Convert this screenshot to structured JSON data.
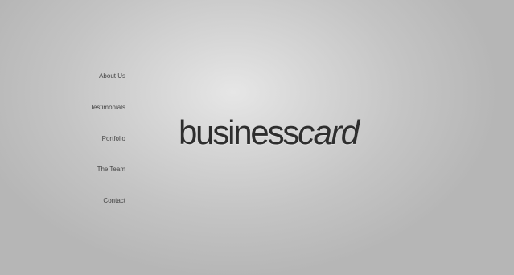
{
  "nav": {
    "items": [
      {
        "label": "About Us"
      },
      {
        "label": "Testimonials"
      },
      {
        "label": "Portfolio"
      },
      {
        "label": "The Team"
      },
      {
        "label": "Contact"
      }
    ]
  },
  "logo": {
    "part_regular": "business",
    "part_italic": "card"
  },
  "colors": {
    "background": "#c4c4c4",
    "background_highlight": "#e6e6e6",
    "nav_text": "#444444",
    "logo_text": "#2e2e2e"
  }
}
